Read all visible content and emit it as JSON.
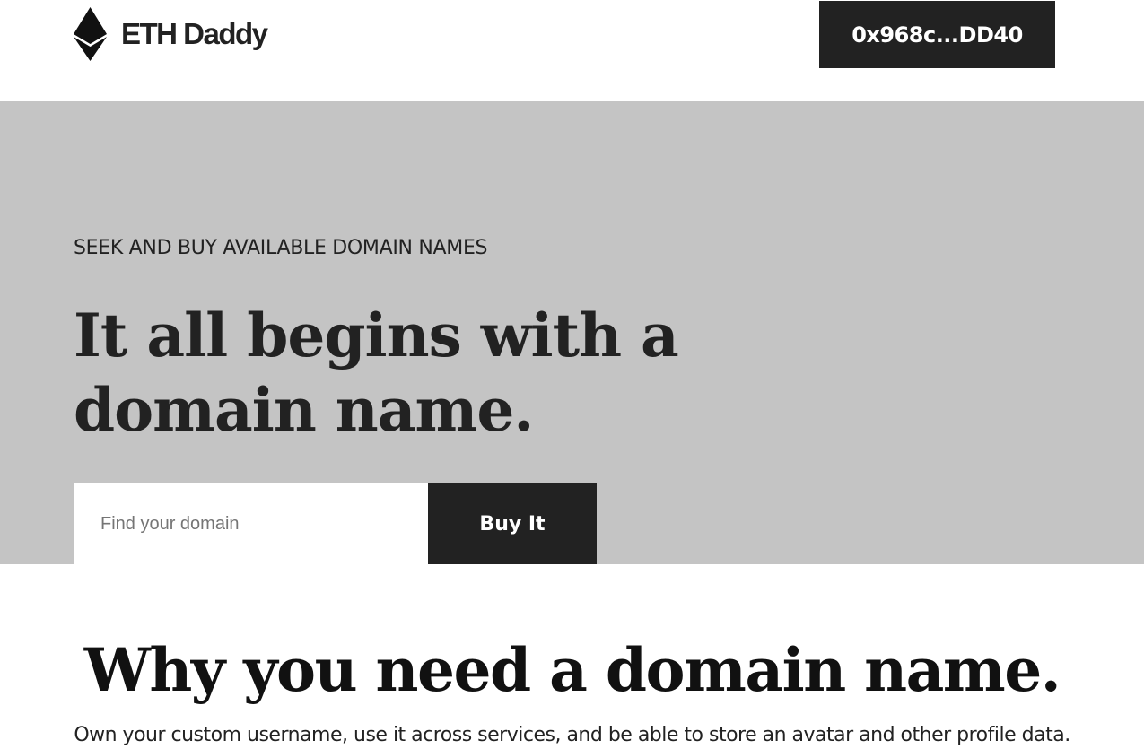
{
  "navbar": {
    "brand_name": "ETH Daddy",
    "logo_icon": "ethereum-diamond-icon",
    "wallet_address": "0x968c...DD40"
  },
  "hero": {
    "eyebrow": "SEEK AND BUY AVAILABLE DOMAIN NAMES",
    "title": "It all begins with a domain name.",
    "search": {
      "value": "",
      "placeholder": "Find your domain"
    },
    "buy_label": "Buy It"
  },
  "why_section": {
    "title": "Why you need a domain name.",
    "description": "Own your custom username, use it across services, and be able to store an avatar and other profile data."
  },
  "colors": {
    "dark": "#222222",
    "hero_background": "#c4c4c4",
    "white": "#ffffff"
  }
}
